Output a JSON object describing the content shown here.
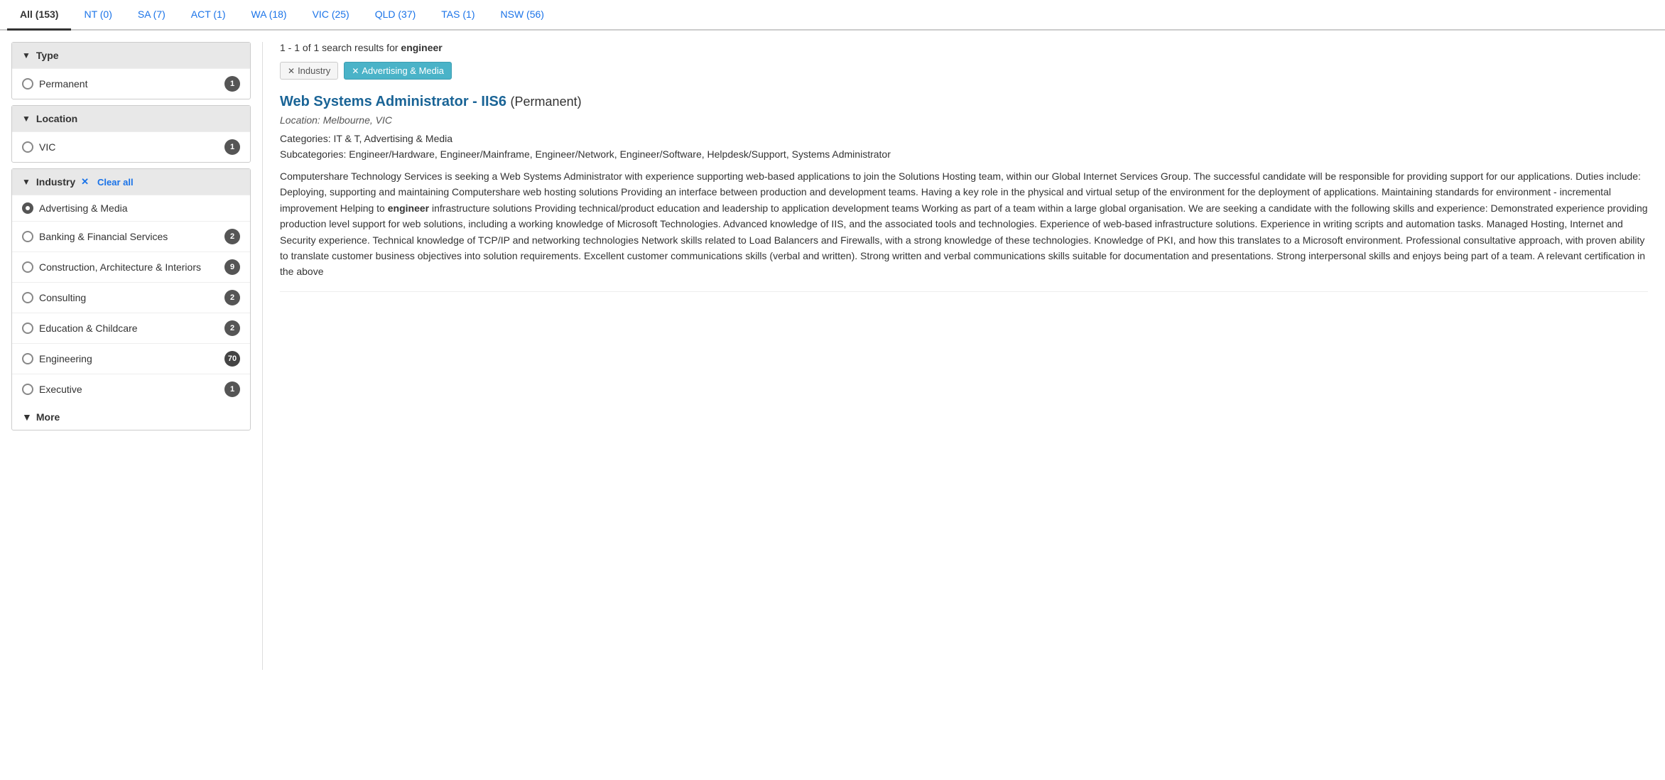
{
  "tabs": [
    {
      "id": "all",
      "label": "All (153)",
      "active": true
    },
    {
      "id": "nt",
      "label": "NT (0)",
      "active": false
    },
    {
      "id": "sa",
      "label": "SA (7)",
      "active": false
    },
    {
      "id": "act",
      "label": "ACT (1)",
      "active": false
    },
    {
      "id": "wa",
      "label": "WA (18)",
      "active": false
    },
    {
      "id": "vic",
      "label": "VIC (25)",
      "active": false
    },
    {
      "id": "qld",
      "label": "QLD (37)",
      "active": false
    },
    {
      "id": "tas",
      "label": "TAS (1)",
      "active": false
    },
    {
      "id": "nsw",
      "label": "NSW (56)",
      "active": false
    }
  ],
  "sidebar": {
    "type_section": {
      "label": "Type",
      "items": [
        {
          "label": "Permanent",
          "count": "1",
          "selected": false
        }
      ]
    },
    "location_section": {
      "label": "Location",
      "items": [
        {
          "label": "VIC",
          "count": "1",
          "selected": false
        }
      ]
    },
    "industry_section": {
      "label": "Industry",
      "clear_all": "Clear all",
      "items": [
        {
          "label": "Advertising & Media",
          "count": null,
          "selected": true
        },
        {
          "label": "Banking & Financial Services",
          "count": "2",
          "selected": false
        },
        {
          "label": "Construction, Architecture & Interiors",
          "count": "9",
          "selected": false
        },
        {
          "label": "Consulting",
          "count": "2",
          "selected": false
        },
        {
          "label": "Education & Childcare",
          "count": "2",
          "selected": false
        },
        {
          "label": "Engineering",
          "count": "70",
          "selected": false
        },
        {
          "label": "Executive",
          "count": "1",
          "selected": false
        }
      ]
    },
    "more_label": "More"
  },
  "results": {
    "info_prefix": "1 - 1 of 1 search results for ",
    "search_term": "engineer"
  },
  "filter_tags": [
    {
      "label": "Industry",
      "type": "plain"
    },
    {
      "label": "Advertising & Media",
      "type": "blue"
    }
  ],
  "job": {
    "title_link": "Web Systems Administrator - IIS6",
    "title_type": "(Permanent)",
    "location": "Location: Melbourne, VIC",
    "categories": "Categories: IT & T, Advertising & Media",
    "subcategories": "Subcategories: Engineer/Hardware, Engineer/Mainframe, Engineer/Network, Engineer/Software, Helpdesk/Support, Systems Administrator",
    "description_before_bold": "Computershare Technology Services is seeking a Web Systems Administrator with experience supporting web-based applications to join the Solutions Hosting team, within our Global Internet Services Group. The successful candidate will be responsible for providing support for our applications. Duties include: Deploying, supporting and maintaining Computershare web hosting solutions Providing an interface between production and development teams. Having a key role in the physical and virtual setup of the environment for the deployment of applications. Maintaining standards for environment - incremental improvement Helping to ",
    "description_bold": "engineer",
    "description_after_bold": " infrastructure solutions Providing technical/product education and leadership to application development teams Working as part of a team within a large global organisation. We are seeking a candidate with the following skills and experience: Demonstrated experience providing production level support for web solutions, including a working knowledge of Microsoft Technologies. Advanced knowledge of IIS, and the associated tools and technologies. Experience of web-based infrastructure solutions. Experience in writing scripts and automation tasks. Managed Hosting, Internet and Security experience. Technical knowledge of TCP/IP and networking technologies Network skills related to Load Balancers and Firewalls, with a strong knowledge of these technologies. Knowledge of PKI, and how this translates to a Microsoft environment. Professional consultative approach, with proven ability to translate customer business objectives into solution requirements. Excellent customer communications skills (verbal and written). Strong written and verbal communications skills suitable for documentation and presentations. Strong interpersonal skills and enjoys being part of a team. A relevant certification in the above"
  }
}
